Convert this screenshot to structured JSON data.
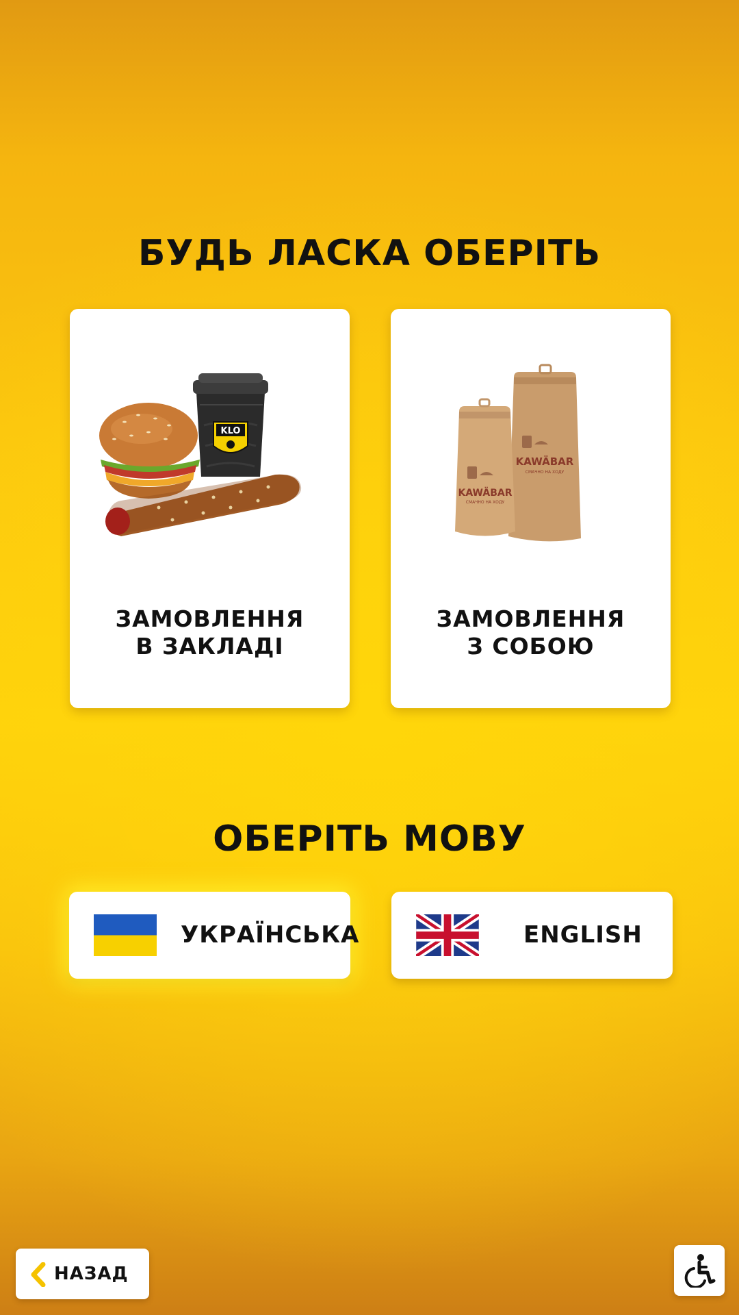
{
  "header": {
    "title": "БУДЬ ЛАСКА ОБЕРІТЬ"
  },
  "order_types": [
    {
      "line1": "ЗАМОВЛЕННЯ",
      "line2": "В ЗАКЛАДІ",
      "art_logo": "KLO"
    },
    {
      "line1": "ЗАМОВЛЕННЯ",
      "line2": "З СОБОЮ",
      "art_brand": "KAWÄBAR",
      "art_tagline": "СМАЧНО НА ХОДУ"
    }
  ],
  "language_section": {
    "title": "ОБЕРІТЬ МОВУ"
  },
  "languages": [
    {
      "label": "УКРАЇНСЬКА",
      "flag": "ukraine-flag-icon",
      "selected": true
    },
    {
      "label": "ENGLISH",
      "flag": "uk-flag-icon",
      "selected": false
    }
  ],
  "footer": {
    "back_label": "НАЗАД",
    "accessibility_icon": "wheelchair-icon"
  },
  "colors": {
    "accent": "#ffd20d",
    "card": "#ffffff",
    "text": "#111111"
  }
}
